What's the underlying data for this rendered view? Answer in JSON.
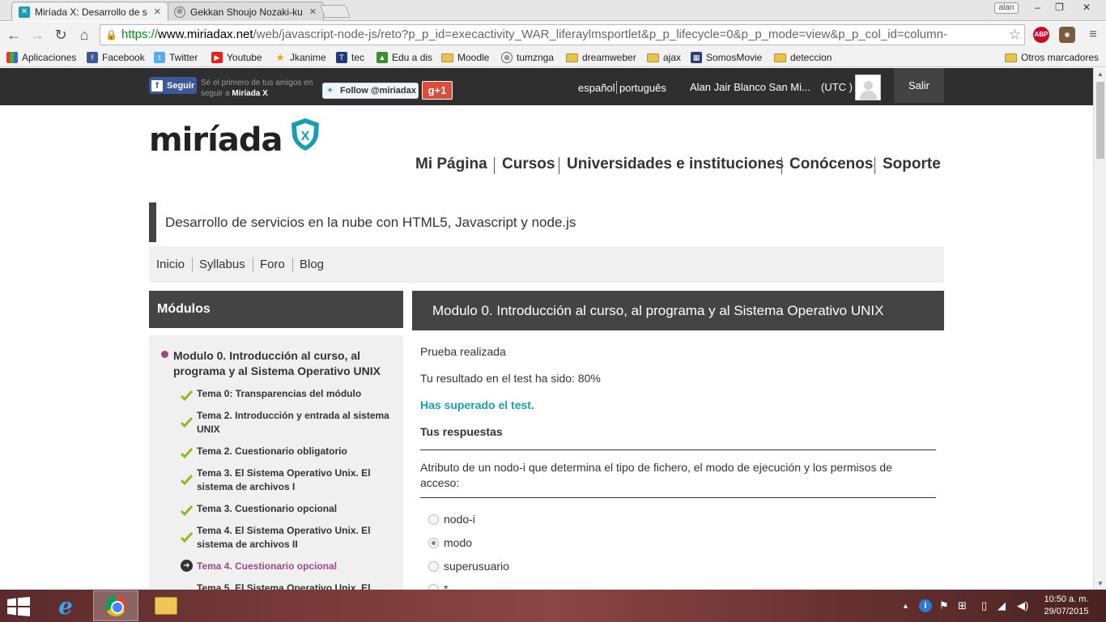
{
  "browser": {
    "tabs": [
      {
        "title": "Miríada X: Desarrollo de s",
        "active": true
      },
      {
        "title": "Gekkan Shoujo Nozaki-ku",
        "active": false
      }
    ],
    "user_badge": "alan",
    "url": {
      "scheme": "https://",
      "host": "www.miriadax.net",
      "path": "/web/javascript-node-js/reto?p_p_id=execactivity_WAR_liferaylmsportlet&p_p_lifecycle=0&p_p_mode=view&p_p_col_id=column-"
    },
    "extensions": [
      {
        "name": "ABP",
        "color": "#c70d2c"
      }
    ],
    "bookmarks": [
      {
        "label": "Aplicaciones",
        "icon": "apps-grid-icon"
      },
      {
        "label": "Facebook",
        "icon": "facebook-icon"
      },
      {
        "label": "Twitter",
        "icon": "twitter-icon"
      },
      {
        "label": "Youtube",
        "icon": "youtube-icon"
      },
      {
        "label": "Jkanime",
        "icon": "star-icon"
      },
      {
        "label": "tec",
        "icon": "tec-icon"
      },
      {
        "label": "Edu a dis",
        "icon": "graduation-icon"
      },
      {
        "label": "Moodle",
        "icon": "folder-icon"
      },
      {
        "label": "tumznga",
        "icon": "globe-icon"
      },
      {
        "label": "dreamweber",
        "icon": "folder-icon"
      },
      {
        "label": "ajax",
        "icon": "folder-icon"
      },
      {
        "label": "SomosMovie",
        "icon": "clapper-icon"
      },
      {
        "label": "deteccion",
        "icon": "folder-icon"
      }
    ],
    "other_bookmarks": "Otros marcadores"
  },
  "topbar": {
    "fb_follow": "Seguir",
    "fb_hint_prefix": "Sé el primero de tus amigos en seguir a ",
    "fb_hint_brand": "Miríada X",
    "tw_follow": "Follow @miriadax",
    "gplus": "g+1",
    "lang_es": "español",
    "lang_pt": "português",
    "user": "Alan Jair Blanco San Mi...",
    "tz": "(UTC )",
    "logout": "Salir"
  },
  "site": {
    "logo": "miríada",
    "logo_mark": "X",
    "nav": [
      "Mi Página",
      "Cursos",
      "Universidades e instituciones",
      "Conócenos",
      "Soporte"
    ],
    "course_title": "Desarrollo de servicios en la nube con HTML5, Javascript y node.js",
    "subnav": [
      "Inicio",
      "Syllabus",
      "Foro",
      "Blog"
    ]
  },
  "modules": {
    "header": "Módulos",
    "current_module": "Modulo 0. Introducción al curso, al programa y al Sistema Operativo UNIX",
    "lessons": [
      {
        "label": "Tema 0: Transparencias del módulo",
        "status": "done"
      },
      {
        "label": "Tema 2. Introducción y entrada al sistema UNIX",
        "status": "done"
      },
      {
        "label": "Tema 2. Cuestionario obligatorio",
        "status": "done"
      },
      {
        "label": "Tema 3. El Sistema Operativo Unix. El sistema de archivos I",
        "status": "done"
      },
      {
        "label": "Tema 3. Cuestionario opcional",
        "status": "done"
      },
      {
        "label": "Tema 4. El Sistema Operativo Unix. El sistema de archivos II",
        "status": "done"
      },
      {
        "label": "Tema 4. Cuestionario opcional",
        "status": "current"
      },
      {
        "label": "Tema 5. El Sistema Operativo Unix. El",
        "status": "pending"
      }
    ]
  },
  "content": {
    "header": "Modulo 0. Introducción al curso, al programa y al Sistema Operativo UNIX",
    "status": "Prueba realizada",
    "result": "Tu resultado en el test ha sido: 80%",
    "passed": "Has superado el test.",
    "answers_title": "Tus respuestas",
    "question": "Atributo de un nodo-i que determina el tipo de fichero, el modo de ejecución y los permisos de acceso:",
    "options": [
      {
        "label": "nodo-i",
        "selected": false
      },
      {
        "label": "modo",
        "selected": true
      },
      {
        "label": "superusuario",
        "selected": false
      },
      {
        "label": "*",
        "selected": false
      }
    ]
  },
  "taskbar": {
    "clock_time": "10:50 a. m.",
    "clock_date": "29/07/2015"
  }
}
